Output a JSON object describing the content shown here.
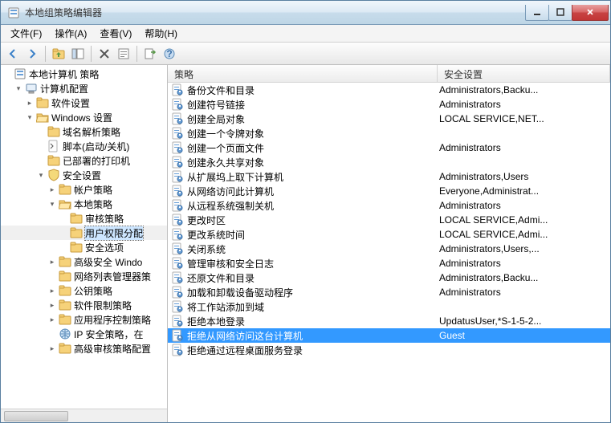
{
  "window": {
    "title": "本地组策略编辑器"
  },
  "menu": {
    "file": "文件(F)",
    "action": "操作(A)",
    "view": "查看(V)",
    "help": "帮助(H)"
  },
  "tree": {
    "root": "本地计算机 策略",
    "n1": "计算机配置",
    "n1_1": "软件设置",
    "n1_2": "Windows 设置",
    "n1_2_1": "域名解析策略",
    "n1_2_2": "脚本(启动/关机)",
    "n1_2_3": "已部署的打印机",
    "n1_2_4": "安全设置",
    "n1_2_4_1": "帐户策略",
    "n1_2_4_2": "本地策略",
    "n1_2_4_2_1": "审核策略",
    "n1_2_4_2_2": "用户权限分配",
    "n1_2_4_2_3": "安全选项",
    "n1_2_4_3": "高级安全 Windo",
    "n1_2_4_4": "网络列表管理器策",
    "n1_2_4_5": "公钥策略",
    "n1_2_4_6": "软件限制策略",
    "n1_2_4_7": "应用程序控制策略",
    "n1_2_4_8": "IP 安全策略，在",
    "n1_2_4_9": "高级审核策略配置"
  },
  "columns": {
    "c1": "策略",
    "c2": "安全设置"
  },
  "policies": [
    {
      "name": "备份文件和目录",
      "setting": "Administrators,Backu..."
    },
    {
      "name": "创建符号链接",
      "setting": "Administrators"
    },
    {
      "name": "创建全局对象",
      "setting": "LOCAL SERVICE,NET..."
    },
    {
      "name": "创建一个令牌对象",
      "setting": ""
    },
    {
      "name": "创建一个页面文件",
      "setting": "Administrators"
    },
    {
      "name": "创建永久共享对象",
      "setting": ""
    },
    {
      "name": "从扩展坞上取下计算机",
      "setting": "Administrators,Users"
    },
    {
      "name": "从网络访问此计算机",
      "setting": "Everyone,Administrat..."
    },
    {
      "name": "从远程系统强制关机",
      "setting": "Administrators"
    },
    {
      "name": "更改时区",
      "setting": "LOCAL SERVICE,Admi..."
    },
    {
      "name": "更改系统时间",
      "setting": "LOCAL SERVICE,Admi..."
    },
    {
      "name": "关闭系统",
      "setting": "Administrators,Users,..."
    },
    {
      "name": "管理审核和安全日志",
      "setting": "Administrators"
    },
    {
      "name": "还原文件和目录",
      "setting": "Administrators,Backu..."
    },
    {
      "name": "加载和卸载设备驱动程序",
      "setting": "Administrators"
    },
    {
      "name": "将工作站添加到域",
      "setting": ""
    },
    {
      "name": "拒绝本地登录",
      "setting": "UpdatusUser,*S-1-5-2..."
    },
    {
      "name": "拒绝从网络访问这台计算机",
      "setting": "Guest",
      "selected": true
    },
    {
      "name": "拒绝通过远程桌面服务登录",
      "setting": ""
    }
  ]
}
